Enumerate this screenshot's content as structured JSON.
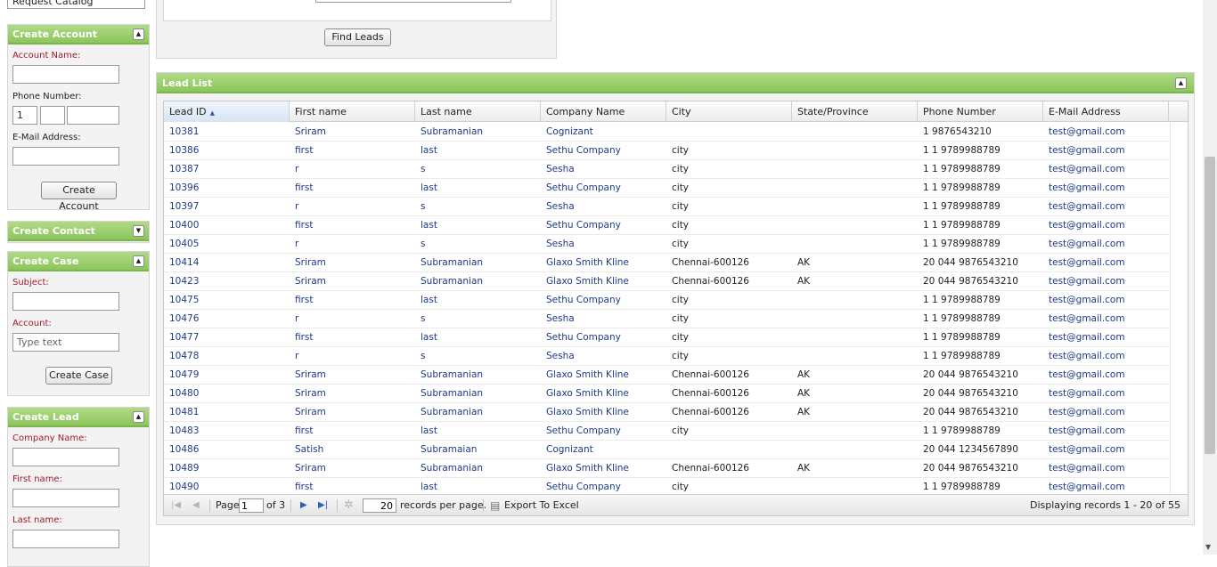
{
  "sidebar": {
    "top_select_value": "Request Catalog",
    "create_account": {
      "title": "Create Account",
      "collapse_icon": "triangle-up-icon",
      "account_name_label": "Account Name:",
      "phone_label": "Phone Number:",
      "phone_country_value": "1",
      "email_label": "E-Mail Address:",
      "button": "Create Account"
    },
    "create_contact": {
      "title": "Create Contact",
      "expand_icon": "triangle-down-icon"
    },
    "create_case": {
      "title": "Create Case",
      "subject_label": "Subject:",
      "account_label": "Account:",
      "account_placeholder": "Type text",
      "button": "Create Case"
    },
    "create_lead": {
      "title": "Create Lead",
      "company_label": "Company Name:",
      "first_name_label": "First name:",
      "last_name_label": "Last name:"
    }
  },
  "search": {
    "button": "Find Leads"
  },
  "lead_list": {
    "title": "Lead List",
    "columns": [
      "Lead ID",
      "First name",
      "Last name",
      "Company Name",
      "City",
      "State/Province",
      "Phone Number",
      "E-Mail Address"
    ],
    "sorted_column": "Lead ID",
    "rows": [
      [
        "10381",
        "Sriram",
        "Subramanian",
        "Cognizant",
        "",
        "",
        "1 9876543210",
        "test@gmail.com"
      ],
      [
        "10386",
        "first",
        "last",
        "Sethu Company",
        "city",
        "",
        "1 1 9789988789",
        "test@gmail.com"
      ],
      [
        "10387",
        "r",
        "s",
        "Sesha",
        "city",
        "",
        "1 1 9789988789",
        "test@gmail.com"
      ],
      [
        "10396",
        "first",
        "last",
        "Sethu Company",
        "city",
        "",
        "1 1 9789988789",
        "test@gmail.com"
      ],
      [
        "10397",
        "r",
        "s",
        "Sesha",
        "city",
        "",
        "1 1 9789988789",
        "test@gmail.com"
      ],
      [
        "10400",
        "first",
        "last",
        "Sethu Company",
        "city",
        "",
        "1 1 9789988789",
        "test@gmail.com"
      ],
      [
        "10405",
        "r",
        "s",
        "Sesha",
        "city",
        "",
        "1 1 9789988789",
        "test@gmail.com"
      ],
      [
        "10414",
        "Sriram",
        "Subramanian",
        "Glaxo Smith Kline",
        "Chennai-600126",
        "AK",
        "20 044 9876543210",
        "test@gmail.com"
      ],
      [
        "10423",
        "Sriram",
        "Subramanian",
        "Glaxo Smith Kline",
        "Chennai-600126",
        "AK",
        "20 044 9876543210",
        "test@gmail.com"
      ],
      [
        "10475",
        "first",
        "last",
        "Sethu Company",
        "city",
        "",
        "1 1 9789988789",
        "test@gmail.com"
      ],
      [
        "10476",
        "r",
        "s",
        "Sesha",
        "city",
        "",
        "1 1 9789988789",
        "test@gmail.com"
      ],
      [
        "10477",
        "first",
        "last",
        "Sethu Company",
        "city",
        "",
        "1 1 9789988789",
        "test@gmail.com"
      ],
      [
        "10478",
        "r",
        "s",
        "Sesha",
        "city",
        "",
        "1 1 9789988789",
        "test@gmail.com"
      ],
      [
        "10479",
        "Sriram",
        "Subramanian",
        "Glaxo Smith Kline",
        "Chennai-600126",
        "AK",
        "20 044 9876543210",
        "test@gmail.com"
      ],
      [
        "10480",
        "Sriram",
        "Subramanian",
        "Glaxo Smith Kline",
        "Chennai-600126",
        "AK",
        "20 044 9876543210",
        "test@gmail.com"
      ],
      [
        "10481",
        "Sriram",
        "Subramanian",
        "Glaxo Smith Kline",
        "Chennai-600126",
        "AK",
        "20 044 9876543210",
        "test@gmail.com"
      ],
      [
        "10483",
        "first",
        "last",
        "Sethu Company",
        "city",
        "",
        "1 1 9789988789",
        "test@gmail.com"
      ],
      [
        "10486",
        "Satish",
        "Subramaian",
        "Cognizant",
        "",
        "",
        "20 044 1234567890",
        "test@gmail.com"
      ],
      [
        "10489",
        "Sriram",
        "Subramanian",
        "Glaxo Smith Kline",
        "Chennai-600126",
        "AK",
        "20 044 9876543210",
        "test@gmail.com"
      ],
      [
        "10490",
        "first",
        "last",
        "Sethu Company",
        "city",
        "",
        "1 1 9789988789",
        "test@gmail.com"
      ]
    ],
    "pager": {
      "page_label": "Page",
      "page_value": "1",
      "of_label": "of 3",
      "per_page_value": "20",
      "per_page_label": "records per page.",
      "export_label": "Export To Excel",
      "display_text": "Displaying records 1 - 20 of 55"
    }
  },
  "colors": {
    "header_green": "#8cc55c",
    "link_blue": "#1e3a8a",
    "required_red": "#a3192b"
  }
}
